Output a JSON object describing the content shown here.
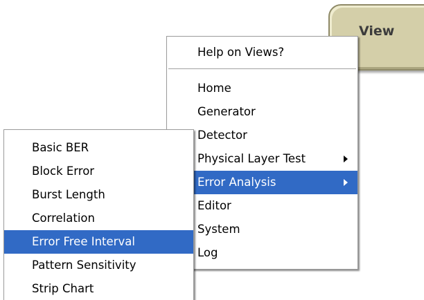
{
  "view_button": {
    "label": "View"
  },
  "view_menu": {
    "help_item": "Help on Views?",
    "items": [
      {
        "label": "Home",
        "has_submenu": false,
        "selected": false
      },
      {
        "label": "Generator",
        "has_submenu": false,
        "selected": false
      },
      {
        "label": "Detector",
        "has_submenu": false,
        "selected": false
      },
      {
        "label": "Physical Layer Test",
        "has_submenu": true,
        "selected": false
      },
      {
        "label": "Error Analysis",
        "has_submenu": true,
        "selected": true
      },
      {
        "label": "Editor",
        "has_submenu": false,
        "selected": false
      },
      {
        "label": "System",
        "has_submenu": false,
        "selected": false
      },
      {
        "label": "Log",
        "has_submenu": false,
        "selected": false
      }
    ]
  },
  "error_analysis_submenu": {
    "items": [
      {
        "label": "Basic BER",
        "selected": false
      },
      {
        "label": "Block Error",
        "selected": false
      },
      {
        "label": "Burst Length",
        "selected": false
      },
      {
        "label": "Correlation",
        "selected": false
      },
      {
        "label": "Error Free Interval",
        "selected": true
      },
      {
        "label": "Pattern Sensitivity",
        "selected": false
      },
      {
        "label": "Strip Chart",
        "selected": false
      }
    ]
  },
  "colors": {
    "highlight": "#316ac5",
    "highlight_text": "#ffffff",
    "menu_background": "#ffffff",
    "view_button_face": "#d4cfa9"
  }
}
